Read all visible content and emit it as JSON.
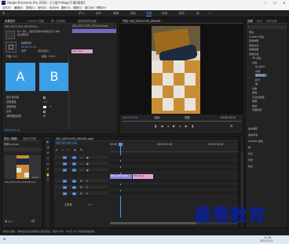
{
  "title_bar": {
    "app_icon": "Pr",
    "title": "Adobe Premiere Pro 2020 - C:\\用户\\Abqi\\下载\\视频1",
    "minimize": "—",
    "maximize": "☐",
    "close": "✕"
  },
  "menu": [
    "文件(F)",
    "编辑(E)",
    "剪辑(C)",
    "序列(S)",
    "标记(M)",
    "图形(G)",
    "视图(V)",
    "窗口(W)",
    "帮助(H)"
  ],
  "workspaces": [
    "学习",
    "组件",
    "编辑",
    "颜色",
    "效果",
    "音频",
    "图形",
    "库"
  ],
  "active_workspace": "效果",
  "effect_controls": {
    "tabs": [
      "效果控件",
      "Lumetri 范围",
      "源: (无剪辑)",
      "音频剪辑混合器"
    ],
    "clip_name": "VID_20211105_091434.m...",
    "seq_label": "VID_20211105_091434.mp4",
    "description_lines": [
      "将 A 滑入、最接近到的B出现在已打入B的",
      "在左侧的拉"
    ],
    "duration_label": "持续时间",
    "duration": "00:00:01:00",
    "alignment_label": "对齐",
    "alignment": "中心切入",
    "a_label": "A",
    "b_label": "B",
    "props": [
      "显示实际源",
      "边框宽度",
      "边框颜色",
      "反向",
      "消除锯齿品质"
    ],
    "props_values": [
      "",
      "0.0",
      "",
      "",
      "中"
    ],
    "clip_badge": "VID_Type",
    "timecode": "00:00:00:14"
  },
  "program_monitor": {
    "tab": "节目: VID_20211105_091434",
    "timecode": "00:00:00:04",
    "fit": "适合",
    "ratio": "完整",
    "duration": "00:00:10:21"
  },
  "effects_panel": {
    "tabs": [
      "效果",
      "标记",
      "历史记录"
    ],
    "items": [
      {
        "label": "预设",
        "level": 0,
        "selected": false
      },
      {
        "label": "Lumetri 预设",
        "level": 0,
        "selected": false
      },
      {
        "label": "音频效果",
        "level": 0,
        "selected": false
      },
      {
        "label": "音频过渡",
        "level": 0,
        "selected": false
      },
      {
        "label": "视频效果",
        "level": 0,
        "selected": false
      },
      {
        "label": "视频过渡",
        "level": 0,
        "selected": false
      },
      {
        "label": "3D 运动",
        "level": 1,
        "selected": false
      },
      {
        "label": "内滑",
        "level": 1,
        "selected": false
      },
      {
        "label": "中心拆分",
        "level": 2,
        "selected": false
      },
      {
        "label": "内滑",
        "level": 2,
        "selected": false
      },
      {
        "label": "带状内滑",
        "level": 2,
        "selected": true
      },
      {
        "label": "拆分",
        "level": 2,
        "selected": false
      },
      {
        "label": "推",
        "level": 2,
        "selected": false
      },
      {
        "label": "划像",
        "level": 1,
        "selected": false
      },
      {
        "label": "擦除",
        "level": 1,
        "selected": false
      },
      {
        "label": "沉浸式视频",
        "level": 1,
        "selected": false
      },
      {
        "label": "溶解",
        "level": 1,
        "selected": false
      },
      {
        "label": "缩放",
        "level": 1,
        "selected": false
      },
      {
        "label": "页面剥落",
        "level": 1,
        "selected": false
      }
    ],
    "sections": [
      "基本图形",
      "基本声音",
      "Lumetri 颜色",
      "库",
      "标记",
      "历史",
      "信息"
    ]
  },
  "project_panel": {
    "tabs": [
      "项目: 视频1",
      "媒体浏览器"
    ],
    "name": "视频1.prproj",
    "search_placeholder": "",
    "thumb_name": "VID_20211105_091434.mp4",
    "thumb_duration": "10:21",
    "item_count": "1项"
  },
  "timeline": {
    "tab": "VID_20211105_091434.mp4",
    "timecode": "00:00:00:04",
    "ruler_labels": [
      "00:00",
      "00:00:05:00",
      "00:00:10:00"
    ],
    "tracks": [
      {
        "name": "V3"
      },
      {
        "name": "V2"
      },
      {
        "name": "V1"
      },
      {
        "name": "A1"
      },
      {
        "name": "A2"
      },
      {
        "name": "A3"
      }
    ],
    "master_label": "主声道",
    "master_value": "0.0",
    "clip_label": "VID_20211105",
    "transition_label": "VID_Type"
  },
  "status_bar": {
    "text": "单击以选择，或单击空白处并拖动以进行框选。使用 Shift、Alt 和 Ctrl 可获得其他选项。"
  },
  "taskbar": {
    "time": "11:29",
    "date": "2021/11/5"
  },
  "watermark": "最需教育",
  "colors": {
    "accent": "#4b9bff",
    "clip": "#8b86e0",
    "transition": "#e4a2d6",
    "ab_tile": "#3ba0e8"
  }
}
